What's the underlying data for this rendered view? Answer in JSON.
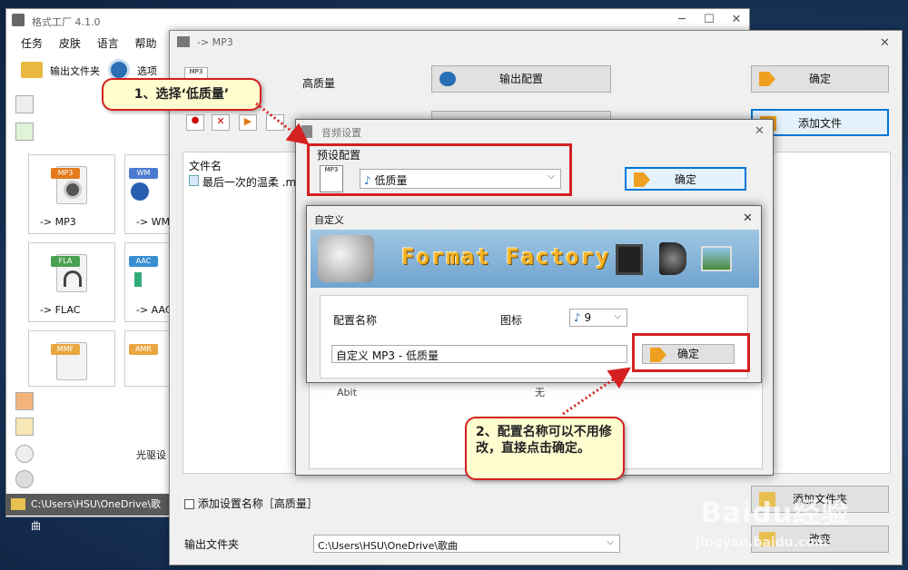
{
  "main_window": {
    "title": "格式工厂 4.1.0",
    "menu": [
      "任务",
      "皮肤",
      "语言",
      "帮助"
    ],
    "toolbar": {
      "output_folder": "输出文件夹",
      "options": "选项"
    },
    "tiles": [
      "-> MP3",
      "-> WM",
      "-> FLAC",
      "-> AAC",
      "",
      ""
    ],
    "tile_tags": [
      "MP3",
      "WM",
      "FLA",
      "AAC",
      "MMF",
      "AMR"
    ],
    "drive_label": "光驱设",
    "status_path": "C:\\Users\\HSU\\OneDrive\\歌曲"
  },
  "mp3_window": {
    "title": "-> MP3",
    "quality_label": "高质量",
    "output_config_btn": "输出配置",
    "ok_btn": "确定",
    "add_file_btn": "添加文件",
    "file_column": "文件名",
    "file_item": "最后一次的温柔 .mp",
    "add_setting_checkbox": "添加设置名称［高质量］",
    "add_folder_btn": "添加文件夹",
    "output_folder_label": "输出文件夹",
    "output_folder_value": "C:\\Users\\HSU\\OneDrive\\歌曲",
    "change_btn": "改变"
  },
  "audio_dialog": {
    "title": "音频设置",
    "preset_label": "预设配置",
    "preset_value": "低质量",
    "ok_btn": "确定",
    "bg_row": [
      "Abit",
      "无"
    ]
  },
  "custom_dialog": {
    "title": "自定义",
    "banner_text": "Format Factory",
    "config_name_label": "配置名称",
    "icon_label": "图标",
    "icon_value": "9",
    "name_value": "自定义 MP3 - 低质量",
    "ok_btn": "确定"
  },
  "callouts": {
    "step1": "1、选择‘低质量’",
    "step2": "2、配置名称可以不用修改，直接点击确定。"
  },
  "watermark": {
    "brand": "Baidu经验",
    "url": "jingyan.baidu.com"
  },
  "colors": {
    "accent_red": "#d42020",
    "callout_bg": "#fffcd0",
    "desktop": "#1c3b62"
  }
}
